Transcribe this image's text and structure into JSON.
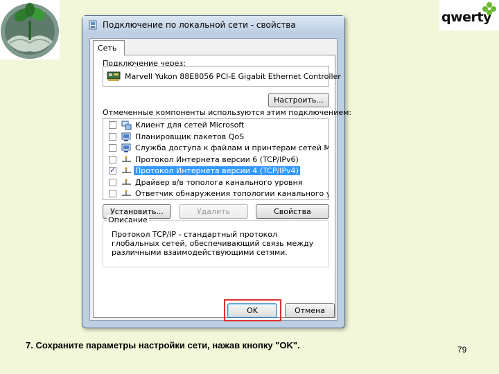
{
  "logo": {
    "brand": "qwerty"
  },
  "dialog": {
    "title": "Подключение по локальной сети - свойства",
    "tab": "Сеть",
    "connect_via_label": "Подключение через:",
    "adapter_name": "Marvell Yukon 88E8056 PCI-E Gigabit Ethernet Controller",
    "configure_button": "Настроить...",
    "components_label": "Отмеченные компоненты используются этим подключением:",
    "components": [
      {
        "label": "Клиент для сетей Microsoft",
        "checked": false,
        "selected": false,
        "icon": "network-client-icon"
      },
      {
        "label": "Планировщик пакетов QoS",
        "checked": false,
        "selected": false,
        "icon": "network-service-icon"
      },
      {
        "label": "Служба доступа к файлам и принтерам сетей Micro...",
        "checked": false,
        "selected": false,
        "icon": "network-service-icon"
      },
      {
        "label": "Протокол Интернета версии 6 (TCP/IPv6)",
        "checked": false,
        "selected": false,
        "icon": "protocol-icon"
      },
      {
        "label": "Протокол Интернета версии 4 (TCP/IPv4)",
        "checked": true,
        "selected": true,
        "icon": "protocol-icon"
      },
      {
        "label": "Драйвер в/в тополога канального уровня",
        "checked": false,
        "selected": false,
        "icon": "protocol-icon"
      },
      {
        "label": "Ответчик обнаружения топологии канального уровня",
        "checked": false,
        "selected": false,
        "icon": "protocol-icon"
      }
    ],
    "install_button": "Установить...",
    "remove_button": "Удалить",
    "properties_button": "Свойства",
    "description_title": "Описание",
    "description_text": "Протокол TCP/IP - стандартный протокол глобальных сетей, обеспечивающий связь между различными взаимодействующими сетями.",
    "ok_button": "OK",
    "cancel_button": "Отмена"
  },
  "caption": "7. Сохраните параметры настройки сети, нажав кнопку \"OK\".",
  "page_number": "79",
  "colors": {
    "background": "#f2f7d9",
    "selection": "#3399ff",
    "highlight_box": "#e0312d"
  }
}
